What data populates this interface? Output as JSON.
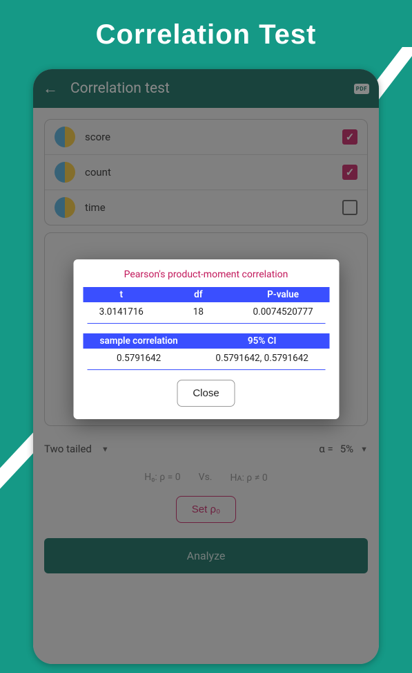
{
  "outer": {
    "title": "Correlation Test"
  },
  "header": {
    "title": "Correlation test",
    "pdf": "PDF"
  },
  "variables": [
    {
      "label": "score",
      "checked": true
    },
    {
      "label": "count",
      "checked": true
    },
    {
      "label": "time",
      "checked": false
    }
  ],
  "controls": {
    "tail": "Two tailed",
    "alpha_label": "α =",
    "alpha_value": "5%",
    "h0": "H₀:  ρ = 0",
    "vs": "Vs.",
    "ha": "Hᴀ:  ρ ≠ 0",
    "set_rho": "Set ρ₀",
    "analyze": "Analyze"
  },
  "modal": {
    "title": "Pearson's product-moment correlation",
    "head1": {
      "t": "t",
      "df": "df",
      "p": "P-value"
    },
    "row1": {
      "t": "3.0141716",
      "df": "18",
      "p": "0.0074520777"
    },
    "head2": {
      "sc": "sample correlation",
      "ci": "95% CI"
    },
    "row2": {
      "sc": "0.5791642",
      "ci": "0.5791642, 0.5791642"
    },
    "close": "Close"
  }
}
